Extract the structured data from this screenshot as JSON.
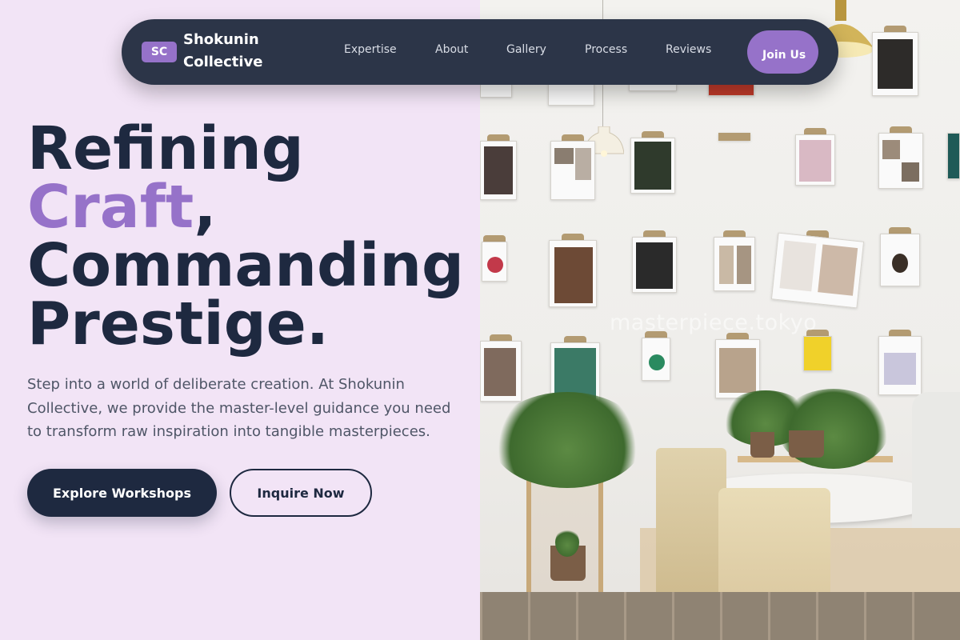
{
  "brand": {
    "badge": "SC",
    "name": "Shokunin Collective"
  },
  "nav": {
    "links": [
      "Expertise",
      "About",
      "Gallery",
      "Process",
      "Reviews"
    ],
    "cta": "Join Us"
  },
  "hero": {
    "headline_line1": "Refining",
    "headline_accent": "Craft",
    "headline_comma": ",",
    "headline_line3": "Commanding",
    "headline_line4": "Prestige.",
    "subtext": "Step into a world of deliberate creation. At Shokunin Collective, we provide the master-level guidance you need to transform raw inspiration into tangible masterpieces.",
    "primary_button": "Explore Workshops",
    "secondary_button": "Inquire Now"
  },
  "image": {
    "watermark": "masterpiece.tokyo"
  },
  "colors": {
    "background": "#f2e4f6",
    "navy": "#1e2940",
    "accent": "#9672c9",
    "nav": "#2c3548"
  }
}
